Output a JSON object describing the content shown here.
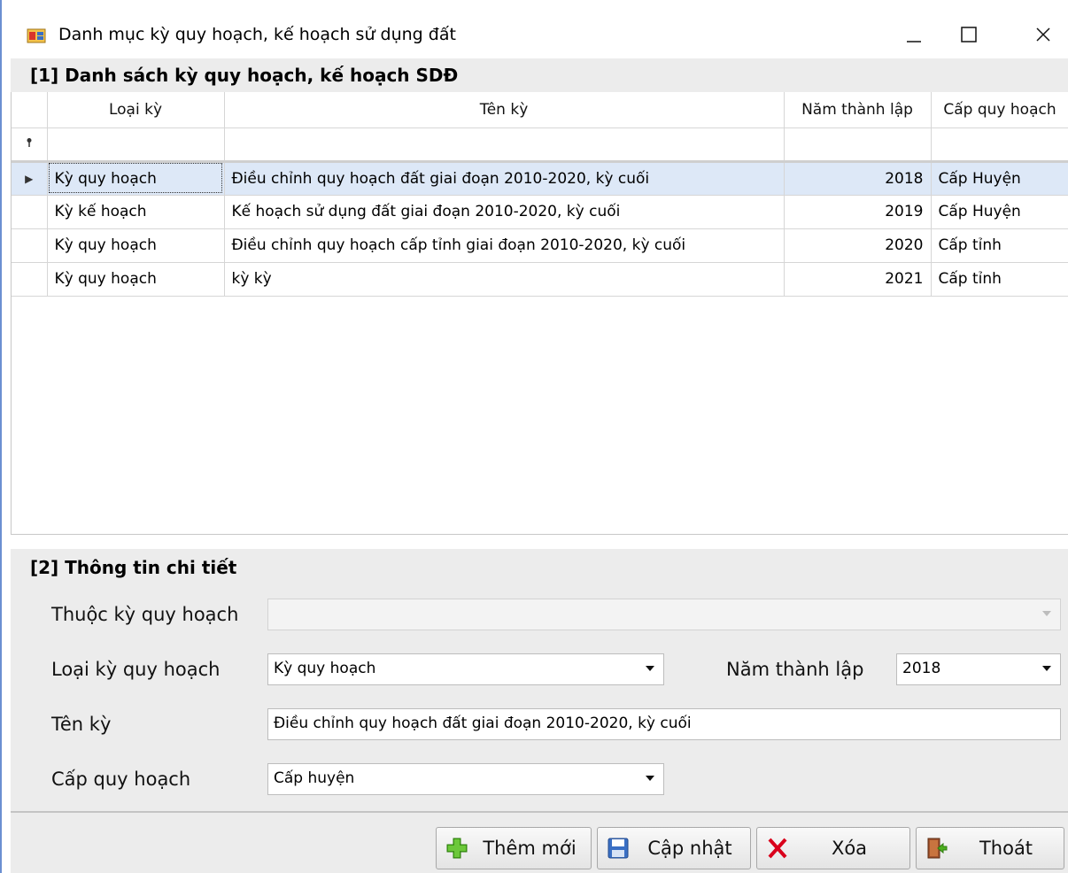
{
  "window": {
    "title": "Danh mục kỳ quy hoạch, kế hoạch sử dụng đất",
    "minimize_icon": "minimize-icon",
    "maximize_icon": "maximize-icon",
    "close_icon": "close-icon"
  },
  "list_section": {
    "title": "[1] Danh sách kỳ quy hoạch, kế hoạch SDĐ",
    "columns": [
      "Loại kỳ",
      "Tên kỳ",
      "Năm thành lập",
      "Cấp quy hoạch"
    ],
    "rows": [
      {
        "loai_ky": "Kỳ quy hoạch",
        "ten_ky": "Điều chỉnh quy hoạch đất giai đoạn 2010-2020, kỳ cuối",
        "nam": "2018",
        "cap": "Cấp Huyện",
        "selected": true
      },
      {
        "loai_ky": "Kỳ kế hoạch",
        "ten_ky": "Kế hoạch sử dụng đất giai đoạn 2010-2020, kỳ cuối",
        "nam": "2019",
        "cap": "Cấp Huyện"
      },
      {
        "loai_ky": "Kỳ quy hoạch",
        "ten_ky": "Điều chỉnh quy hoạch cấp tỉnh giai đoạn 2010-2020, kỳ cuối",
        "nam": "2020",
        "cap": "Cấp tỉnh"
      },
      {
        "loai_ky": "Kỳ quy hoạch",
        "ten_ky": "kỳ kỳ",
        "nam": "2021",
        "cap": "Cấp tỉnh"
      }
    ]
  },
  "detail_section": {
    "title": "[2] Thông tin chi tiết",
    "thuoc_ky_label": "Thuộc kỳ quy hoạch",
    "thuoc_ky_value": "",
    "loai_ky_label": "Loại kỳ quy hoạch",
    "loai_ky_value": "Kỳ quy hoạch",
    "nam_label": "Năm thành lập",
    "nam_value": "2018",
    "ten_ky_label": "Tên kỳ",
    "ten_ky_value": "Điều chỉnh quy hoạch đất giai đoạn 2010-2020, kỳ cuối",
    "cap_label": "Cấp quy hoạch",
    "cap_value": "Cấp huyện"
  },
  "buttons": {
    "add": "Thêm mới",
    "update": "Cập nhật",
    "delete": "Xóa",
    "exit": "Thoát"
  },
  "colors": {
    "selected_row": "#dde8f7",
    "section_bg": "#ececec",
    "add_icon": "#4cae1e",
    "delete_icon": "#d9001b"
  }
}
